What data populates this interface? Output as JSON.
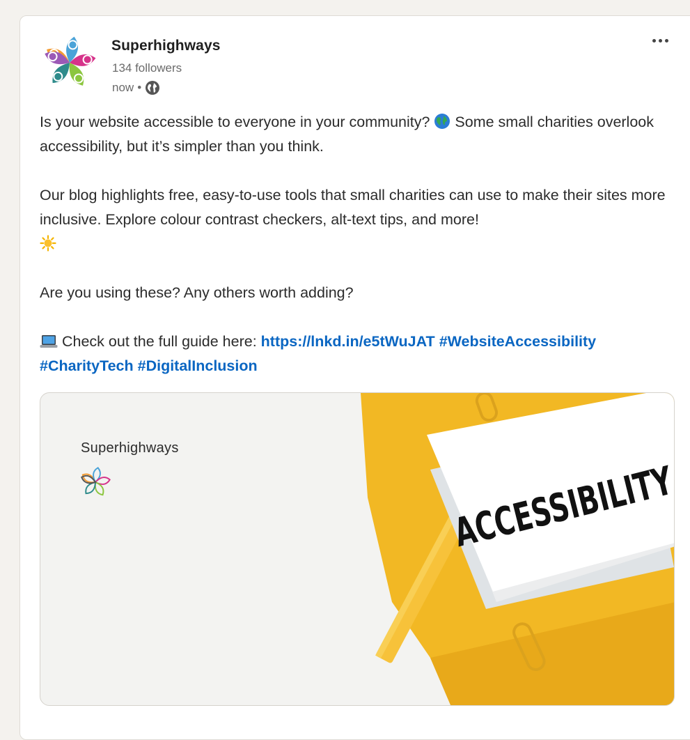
{
  "post": {
    "author": "Superhighways",
    "followers": "134 followers",
    "time": "now",
    "time_separator": "•",
    "paragraphs": {
      "p1": "Is your website accessible to everyone in your community?",
      "p1b": "Some small charities overlook accessibility, but it’s simpler than you think.",
      "p2": "Our blog highlights free, easy-to-use tools that small charities can use to make their sites more inclusive. Explore colour contrast checkers, alt-text tips, and more!",
      "p3": "Are you using these? Any others worth adding?",
      "p4": "Check out the full guide here:"
    },
    "link": "https://lnkd.in/e5tWuJAT",
    "hashtags": [
      "#WebsiteAccessibility",
      "#CharityTech",
      "#DigitalInclusion"
    ],
    "emoji": {
      "globe": "globe-emoji",
      "sun": "sun-emoji",
      "laptop": "laptop-emoji"
    }
  },
  "preview": {
    "brand": "Superhighways",
    "sign_text": "ACCESSIBILITY"
  },
  "colors": {
    "link": "#0a66c2",
    "background": "#f4f2ee",
    "folder_yellow": "#f2b824"
  },
  "icons": [
    "more-options-icon",
    "globe-icon",
    "superhighways-logo"
  ]
}
